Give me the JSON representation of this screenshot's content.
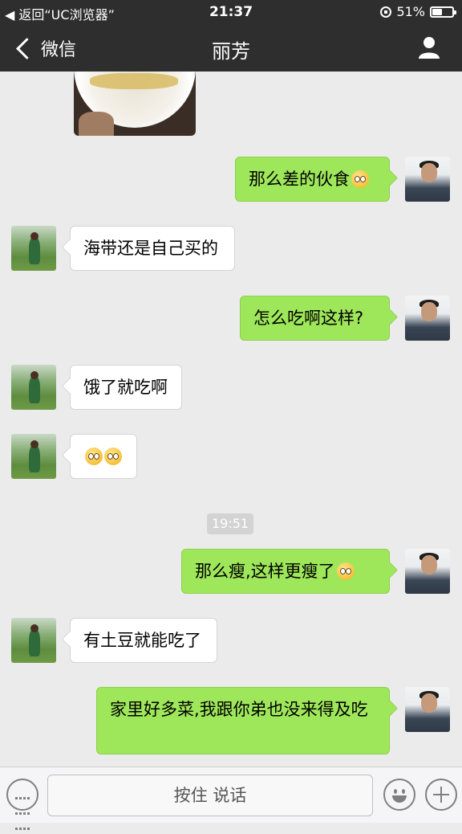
{
  "status_bar": {
    "back_app": "◀ 返回“UC浏览器”",
    "time": "21:37",
    "battery": "51%",
    "battery_level": 0.51
  },
  "nav": {
    "back_label": "微信",
    "title": "丽芳",
    "profile_icon": "person-icon"
  },
  "messages": [
    {
      "sender": "me",
      "text": "那么差的伙食",
      "emoji": 1
    },
    {
      "sender": "her",
      "text": "海带还是自己买的",
      "emoji": 0
    },
    {
      "sender": "me",
      "text": "怎么吃啊这样?",
      "emoji": 0
    },
    {
      "sender": "her",
      "text": "饿了就吃啊",
      "emoji": 0
    },
    {
      "sender": "her",
      "text": "",
      "emoji": 2
    },
    {
      "timestamp": "19:51"
    },
    {
      "sender": "me",
      "text": "那么瘦,这样更瘦了",
      "emoji": 1
    },
    {
      "sender": "her",
      "text": "有土豆就能吃了",
      "emoji": 0
    },
    {
      "sender": "me",
      "text": "家里好多菜,我跟你弟也没来得及吃",
      "emoji": 0
    }
  ],
  "input_bar": {
    "hold_to_talk": "按住 说话",
    "keyboard_icon": "keyboard-icon",
    "emoji_icon": "emoji-icon",
    "plus_icon": "plus-icon"
  },
  "colors": {
    "bar": "#2e2e2e",
    "chat_bg": "#ebebeb",
    "my_bubble": "#9fe75a",
    "her_bubble": "#ffffff"
  }
}
